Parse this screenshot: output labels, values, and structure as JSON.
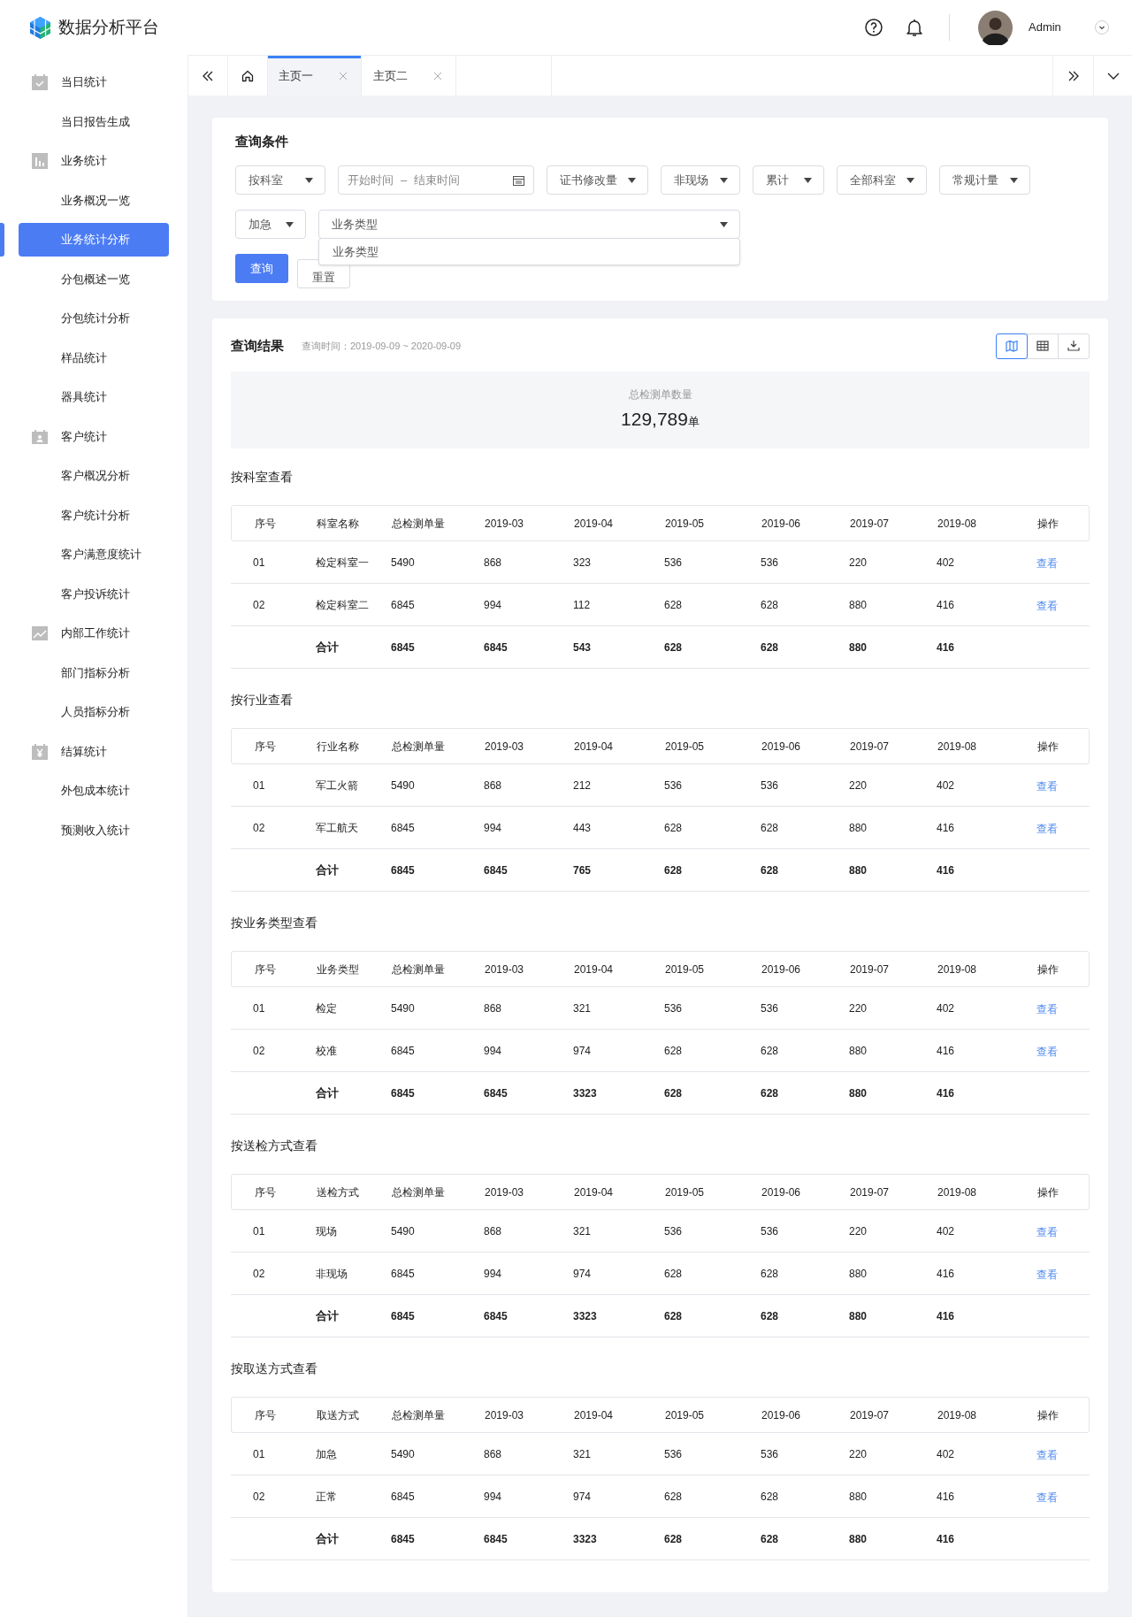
{
  "header": {
    "app_title": "数据分析平台",
    "user_name": "Admin"
  },
  "sidebar": {
    "groups": [
      {
        "label": "当日统计",
        "children": [
          {
            "label": "当日报告生成",
            "selected": false
          }
        ]
      },
      {
        "label": "业务统计",
        "children": [
          {
            "label": "业务概况一览",
            "selected": false
          },
          {
            "label": "业务统计分析",
            "selected": true
          },
          {
            "label": "分包概述一览",
            "selected": false
          },
          {
            "label": "分包统计分析",
            "selected": false
          },
          {
            "label": "样品统计",
            "selected": false
          },
          {
            "label": "器具统计",
            "selected": false
          }
        ]
      },
      {
        "label": "客户统计",
        "children": [
          {
            "label": "客户概况分析",
            "selected": false
          },
          {
            "label": "客户统计分析",
            "selected": false
          },
          {
            "label": "客户满意度统计",
            "selected": false
          },
          {
            "label": "客户投诉统计",
            "selected": false
          }
        ]
      },
      {
        "label": "内部工作统计",
        "children": [
          {
            "label": "部门指标分析",
            "selected": false
          },
          {
            "label": "人员指标分析",
            "selected": false
          }
        ]
      },
      {
        "label": "结算统计",
        "children": [
          {
            "label": "外包成本统计",
            "selected": false
          },
          {
            "label": "预测收入统计",
            "selected": false
          }
        ]
      }
    ]
  },
  "tabs": [
    {
      "label": "主页一",
      "selected": true
    },
    {
      "label": "主页二",
      "selected": false
    }
  ],
  "query": {
    "title": "查询条件",
    "filters_row1": [
      {
        "kind": "select",
        "value": "按科室"
      },
      {
        "kind": "daterange",
        "start_placeholder": "开始时间",
        "separator": "–",
        "end_placeholder": "结束时间"
      },
      {
        "kind": "select",
        "value": "证书修改量"
      },
      {
        "kind": "select",
        "value": "非现场"
      },
      {
        "kind": "select",
        "value": "累计"
      },
      {
        "kind": "select",
        "value": "全部科室"
      },
      {
        "kind": "select",
        "value": "常规计量"
      }
    ],
    "filters_row2": [
      {
        "kind": "select",
        "value": "加急"
      },
      {
        "kind": "wide_select",
        "value": "业务类型"
      }
    ],
    "dropdown_option": "业务类型",
    "buttons": [
      {
        "label": "查询",
        "primary": true
      },
      {
        "label": "重置",
        "primary": false
      }
    ]
  },
  "results": {
    "title": "查询结果",
    "time_range": "查询时间：2019-09-09 ~ 2020-09-09",
    "view_buttons": [
      {
        "selected": true
      },
      {
        "selected": false
      },
      {
        "selected": false
      }
    ],
    "summary": {
      "label": "总检测单数量",
      "value": "129,789",
      "unit": "单"
    },
    "sections": [
      {
        "title": "按科室查看",
        "columns": [
          "序号",
          "科室名称",
          "总检测单量",
          "2019-03",
          "2019-04",
          "2019-05",
          "2019-06",
          "2019-07",
          "2019-08",
          "操作"
        ],
        "rows": [
          {
            "kind": "data",
            "cells": [
              "01",
              "检定科室一",
              "5490",
              "868",
              "323",
              "536",
              "536",
              "220",
              "402"
            ],
            "action": "查看"
          },
          {
            "kind": "data",
            "cells": [
              "02",
              "检定科室二",
              "6845",
              "994",
              "112",
              "628",
              "628",
              "880",
              "416"
            ],
            "action": "查看"
          },
          {
            "kind": "total",
            "cells": [
              "",
              "合计",
              "6845",
              "6845",
              "543",
              "628",
              "628",
              "880",
              "416"
            ]
          }
        ]
      },
      {
        "title": "按行业查看",
        "columns": [
          "序号",
          "行业名称",
          "总检测单量",
          "2019-03",
          "2019-04",
          "2019-05",
          "2019-06",
          "2019-07",
          "2019-08",
          "操作"
        ],
        "rows": [
          {
            "kind": "data",
            "cells": [
              "01",
              "军工火箭",
              "5490",
              "868",
              "212",
              "536",
              "536",
              "220",
              "402"
            ],
            "action": "查看"
          },
          {
            "kind": "data",
            "cells": [
              "02",
              "军工航天",
              "6845",
              "994",
              "443",
              "628",
              "628",
              "880",
              "416"
            ],
            "action": "查看"
          },
          {
            "kind": "total",
            "cells": [
              "",
              "合计",
              "6845",
              "6845",
              "765",
              "628",
              "628",
              "880",
              "416"
            ]
          }
        ]
      },
      {
        "title": "按业务类型查看",
        "columns": [
          "序号",
          "业务类型",
          "总检测单量",
          "2019-03",
          "2019-04",
          "2019-05",
          "2019-06",
          "2019-07",
          "2019-08",
          "操作"
        ],
        "rows": [
          {
            "kind": "data",
            "cells": [
              "01",
              "检定",
              "5490",
              "868",
              "321",
              "536",
              "536",
              "220",
              "402"
            ],
            "action": "查看"
          },
          {
            "kind": "data",
            "cells": [
              "02",
              "校准",
              "6845",
              "994",
              "974",
              "628",
              "628",
              "880",
              "416"
            ],
            "action": "查看"
          },
          {
            "kind": "total",
            "cells": [
              "",
              "合计",
              "6845",
              "6845",
              "3323",
              "628",
              "628",
              "880",
              "416"
            ]
          }
        ]
      },
      {
        "title": "按送检方式查看",
        "columns": [
          "序号",
          "送检方式",
          "总检测单量",
          "2019-03",
          "2019-04",
          "2019-05",
          "2019-06",
          "2019-07",
          "2019-08",
          "操作"
        ],
        "rows": [
          {
            "kind": "data",
            "cells": [
              "01",
              "现场",
              "5490",
              "868",
              "321",
              "536",
              "536",
              "220",
              "402"
            ],
            "action": "查看"
          },
          {
            "kind": "data",
            "cells": [
              "02",
              "非现场",
              "6845",
              "994",
              "974",
              "628",
              "628",
              "880",
              "416"
            ],
            "action": "查看"
          },
          {
            "kind": "total",
            "cells": [
              "",
              "合计",
              "6845",
              "6845",
              "3323",
              "628",
              "628",
              "880",
              "416"
            ]
          }
        ]
      },
      {
        "title": "按取送方式查看",
        "columns": [
          "序号",
          "取送方式",
          "总检测单量",
          "2019-03",
          "2019-04",
          "2019-05",
          "2019-06",
          "2019-07",
          "2019-08",
          "操作"
        ],
        "rows": [
          {
            "kind": "data",
            "cells": [
              "01",
              "加急",
              "5490",
              "868",
              "321",
              "536",
              "536",
              "220",
              "402"
            ],
            "action": "查看"
          },
          {
            "kind": "data",
            "cells": [
              "02",
              "正常",
              "6845",
              "994",
              "974",
              "628",
              "628",
              "880",
              "416"
            ],
            "action": "查看"
          },
          {
            "kind": "total",
            "cells": [
              "",
              "合计",
              "6845",
              "6845",
              "3323",
              "628",
              "628",
              "880",
              "416"
            ]
          }
        ]
      }
    ]
  }
}
